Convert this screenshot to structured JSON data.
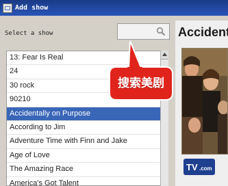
{
  "window": {
    "title": "Add show"
  },
  "search": {
    "label": "Select a show",
    "placeholder": ""
  },
  "shows": [
    "13: Fear Is Real",
    "24",
    "30 rock",
    "90210",
    "Accidentally on Purpose",
    "According to Jim",
    "Adventure Time with Finn and Jake",
    "Age of Love",
    "The Amazing Race",
    "America's Got Talent"
  ],
  "selected_show": "Accidentally on Purpose",
  "details": {
    "title": "Accident",
    "logo_text": "TV.com"
  },
  "callout": {
    "text": "搜索美剧"
  },
  "colors": {
    "selection": "#3a66b8",
    "callout": "#e0241c",
    "titlebar": "#1f4aa3"
  }
}
